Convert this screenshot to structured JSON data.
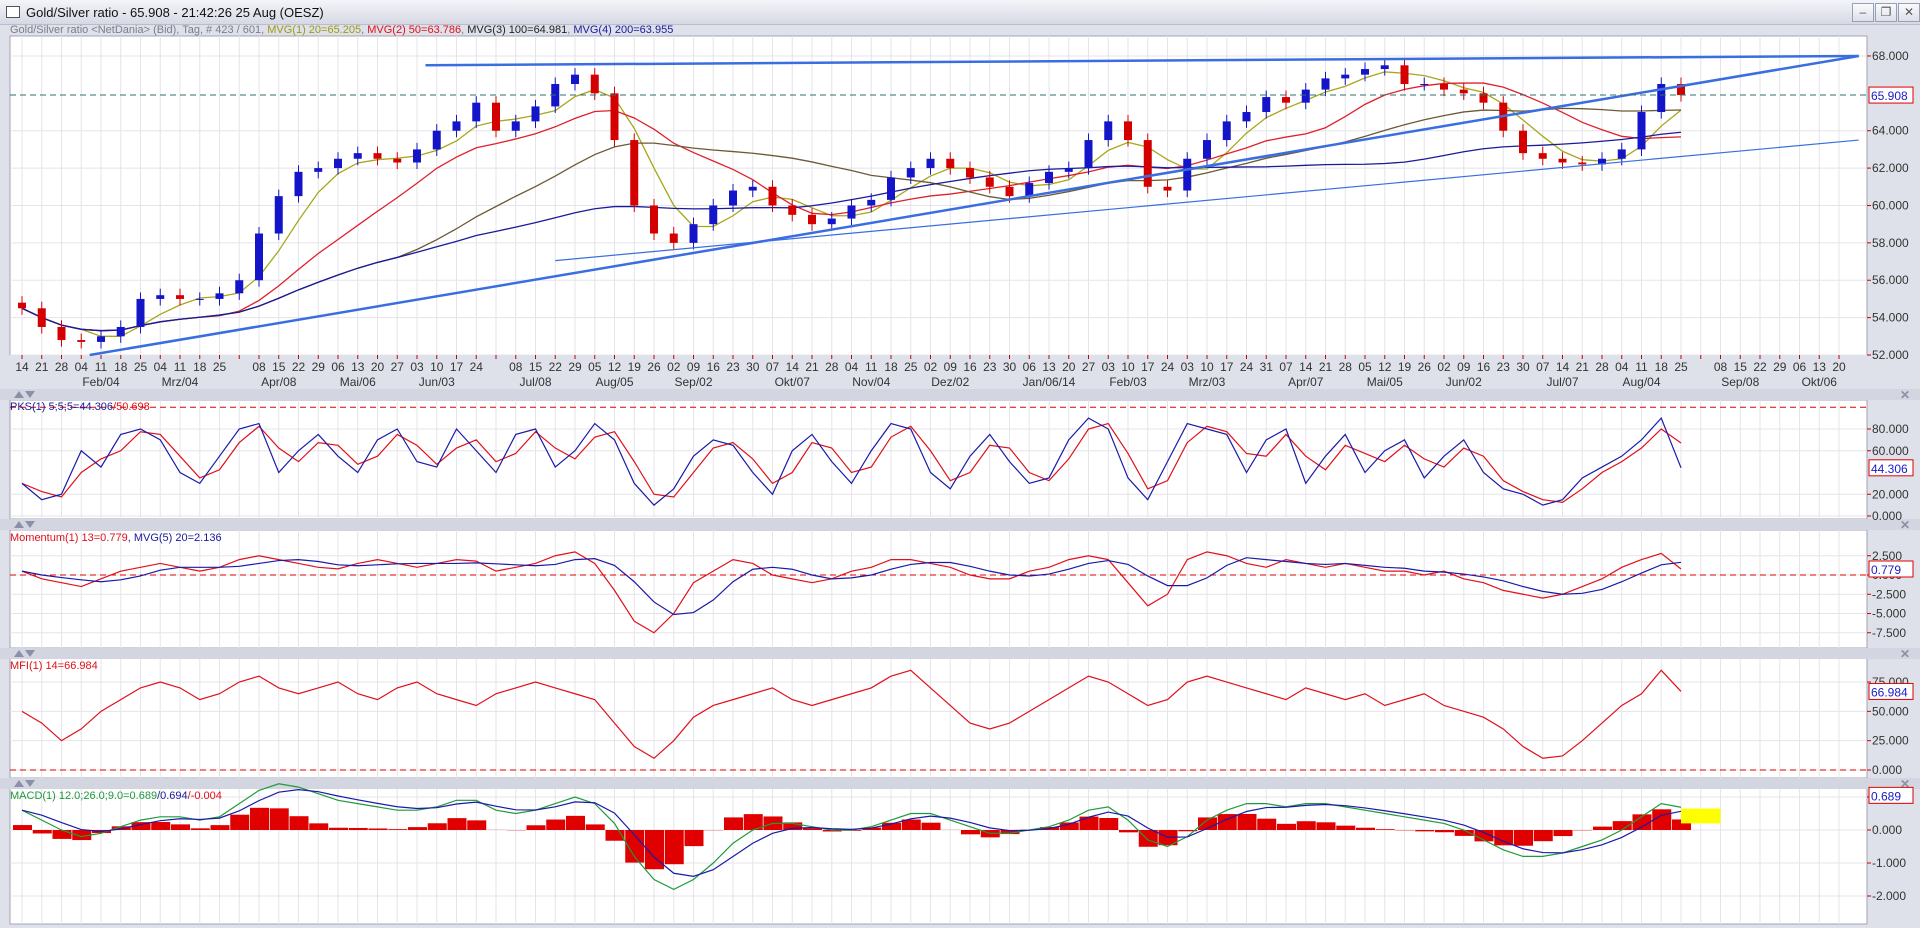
{
  "window": {
    "title": "Gold/Silver ratio - 65.908 - 21:42:26  25 Aug (OESZ)",
    "buttons": {
      "minimize": "–",
      "restore": "❐",
      "close": "✕"
    }
  },
  "legend": {
    "main_prefix": "Gold/Silver ratio <NetDania> (Bid), Tag, # 423 / 601",
    "mvg1": "MVG(1) 20=65.205",
    "mvg2": "MVG(2) 50=63.786",
    "mvg3": "MVG(3) 100=64.981",
    "mvg4": "MVG(4) 200=63.955",
    "sep": ", ",
    "pks_a": "PKS(1) 5;5;5=44.306",
    "pks_b": "/50.698",
    "mom_a": "Momentum(1) 13=0.779",
    "mom_b": "MVG(5) 20=2.136",
    "mfi": "MFI(1) 14=66.984",
    "macd_a": "MACD(1) 12.0;26.0;9.0=0.689",
    "macd_b": "/0.694",
    "macd_c": "/-0.004"
  },
  "colors": {
    "up_candle": "#1414c8",
    "down_candle": "#d40000",
    "mvg1": "#a8a61a",
    "mvg2": "#e0202a",
    "mvg3": "#6b5a34",
    "mvg4": "#1a1a9a",
    "trendline": "#3a6ee0",
    "price_line": "#2f6f6f",
    "pks_k": "#1a1aa8",
    "pks_d": "#e0101a",
    "momentum": "#e0101a",
    "momentum_ma": "#1a1aa8",
    "mfi": "#e0101a",
    "macd": "#1f9a3a",
    "macd_signal": "#1a1aa8",
    "macd_hist": "#e00000",
    "highlight": "#ffff00"
  },
  "chart_data": [
    {
      "type": "candlestick",
      "panel": "price",
      "x_ticks": [
        "14",
        "21",
        "28",
        "04",
        "11",
        "18",
        "25",
        "04",
        "11",
        "18",
        "25",
        "",
        "08",
        "15",
        "22",
        "29",
        "06",
        "13",
        "20",
        "27",
        "03",
        "10",
        "17",
        "24",
        "",
        "08",
        "15",
        "22",
        "29",
        "05",
        "12",
        "19",
        "26",
        "02",
        "09",
        "16",
        "23",
        "30",
        "07",
        "14",
        "21",
        "28",
        "04",
        "11",
        "18",
        "25",
        "02",
        "09",
        "16",
        "23",
        "30",
        "06",
        "13",
        "20",
        "27",
        "03",
        "10",
        "17",
        "24",
        "03",
        "10",
        "17",
        "24",
        "31",
        "07",
        "14",
        "21",
        "28",
        "05",
        "12",
        "19",
        "26",
        "02",
        "09",
        "16",
        "23",
        "30",
        "07",
        "14",
        "21",
        "28",
        "04",
        "11",
        "18",
        "25",
        "",
        "08",
        "15",
        "22",
        "29",
        "06",
        "13",
        "20"
      ],
      "months": [
        "Feb/04",
        "Mrz/04",
        "Apr/08",
        "Mai/06",
        "Jun/03",
        "Jul/08",
        "Aug/05",
        "Sep/02",
        "Okt/07",
        "Nov/04",
        "Dez/02",
        "Jan/06/14",
        "Feb/03",
        "Mrz/03",
        "Apr/07",
        "Mai/05",
        "Jun/02",
        "Jul/07",
        "Aug/04",
        "Sep/08",
        "Okt/06"
      ],
      "close": [
        54.5,
        53.5,
        52.8,
        52.7,
        53.0,
        53.5,
        55.0,
        55.2,
        55.0,
        55.0,
        55.3,
        56.0,
        58.5,
        60.5,
        61.8,
        62.0,
        62.5,
        62.8,
        62.5,
        62.3,
        63.0,
        64.0,
        64.5,
        65.5,
        64.0,
        64.5,
        65.3,
        66.5,
        67.0,
        66.0,
        63.5,
        60.0,
        58.5,
        58.0,
        59.0,
        60.0,
        60.8,
        61.0,
        60.0,
        59.5,
        59.0,
        59.3,
        60.0,
        60.3,
        61.5,
        62.0,
        62.5,
        62.0,
        61.5,
        61.0,
        60.5,
        61.2,
        61.8,
        62.0,
        63.5,
        64.5,
        63.5,
        61.0,
        60.8,
        62.5,
        63.5,
        64.5,
        65.0,
        65.8,
        65.5,
        66.2,
        66.8,
        67.0,
        67.3,
        67.5,
        66.5,
        66.5,
        66.2,
        66.0,
        65.5,
        64.0,
        62.8,
        62.5,
        62.3,
        62.2,
        62.5,
        63.0,
        65.0,
        66.5,
        65.908
      ],
      "moving_averages": [
        "MVG(1) 20",
        "MVG(2) 50",
        "MVG(3) 100",
        "MVG(4) 200"
      ],
      "current_value": "65.908",
      "y_ticks": [
        "52.000",
        "54.000",
        "56.000",
        "58.000",
        "60.000",
        "62.000",
        "64.000",
        "68.000"
      ],
      "ylim": [
        52,
        68
      ],
      "trendlines": [
        {
          "start": {
            "x": "2013-06-06",
            "y": 67.5
          },
          "end": {
            "x": "2014-10-27",
            "y": 68.0
          },
          "width": "thick"
        },
        {
          "start": {
            "x": "2013-02-07",
            "y": 52.0
          },
          "end": {
            "x": "2014-10-27",
            "y": 68.0
          },
          "width": "thick"
        },
        {
          "start": {
            "x": "2013-07-22",
            "y": 57.05
          },
          "end": {
            "x": "2014-10-27",
            "y": 63.5
          },
          "width": "thin"
        }
      ],
      "horizontal_line": 65.908,
      "grid": true
    },
    {
      "type": "line",
      "panel": "PKS",
      "k": [
        30,
        15,
        20,
        60,
        45,
        75,
        80,
        70,
        40,
        30,
        55,
        80,
        85,
        40,
        60,
        75,
        55,
        40,
        70,
        80,
        50,
        45,
        80,
        60,
        40,
        75,
        80,
        45,
        60,
        85,
        70,
        30,
        10,
        25,
        55,
        70,
        65,
        40,
        20,
        60,
        75,
        50,
        30,
        60,
        85,
        80,
        40,
        25,
        55,
        75,
        50,
        30,
        35,
        70,
        90,
        80,
        35,
        15,
        50,
        85,
        80,
        75,
        40,
        70,
        80,
        30,
        55,
        75,
        40,
        60,
        70,
        35,
        55,
        70,
        40,
        25,
        20,
        10,
        15,
        35,
        45,
        55,
        70,
        90,
        44.306
      ],
      "current_value": "44.306",
      "y_ticks": [
        "0.000",
        "20.000",
        "60.000",
        "80.000"
      ],
      "ylim": [
        0,
        100
      ],
      "reference_line": 100
    },
    {
      "type": "line",
      "panel": "Momentum",
      "values": [
        0.5,
        -0.5,
        -1,
        -1.5,
        -0.5,
        0.5,
        1,
        1.5,
        1,
        0.5,
        1,
        2,
        2.5,
        2,
        1.5,
        1,
        0.8,
        1.5,
        2,
        1.5,
        1,
        1.5,
        2,
        1.8,
        0.5,
        1,
        1.5,
        2.5,
        3,
        1.5,
        -2,
        -6,
        -7.5,
        -5,
        -1,
        0.5,
        2,
        1.5,
        0,
        -0.5,
        -1,
        -0.5,
        0.5,
        1,
        2,
        2,
        1.5,
        1,
        0,
        -0.5,
        -0.5,
        0.5,
        1,
        2,
        2.5,
        2,
        -1,
        -4,
        -2.5,
        2,
        3,
        2.5,
        1.5,
        1,
        2,
        1.5,
        1,
        1.5,
        1,
        0.5,
        0.5,
        0,
        0.5,
        -0.5,
        -1,
        -2,
        -2.5,
        -3,
        -2.5,
        -1.5,
        -0.5,
        1,
        2,
        2.8,
        0.779
      ],
      "current_value": "0.779",
      "y_ticks": [
        "2.500",
        "0.000",
        "-2.500",
        "-5.000",
        "-7.500"
      ],
      "ylim": [
        -8.5,
        5
      ],
      "reference_line": 0
    },
    {
      "type": "line",
      "panel": "MFI",
      "values": [
        50,
        40,
        25,
        35,
        50,
        60,
        70,
        75,
        70,
        60,
        65,
        75,
        80,
        70,
        65,
        70,
        75,
        65,
        60,
        70,
        75,
        65,
        60,
        55,
        65,
        70,
        75,
        70,
        65,
        60,
        40,
        20,
        10,
        25,
        45,
        55,
        60,
        65,
        70,
        60,
        55,
        60,
        65,
        70,
        80,
        85,
        70,
        55,
        40,
        35,
        40,
        50,
        60,
        70,
        80,
        75,
        65,
        55,
        60,
        75,
        80,
        75,
        70,
        65,
        60,
        70,
        65,
        60,
        65,
        55,
        60,
        65,
        55,
        50,
        45,
        35,
        20,
        10,
        12,
        25,
        40,
        55,
        65,
        85,
        66.984
      ],
      "current_value": "66.984",
      "y_ticks": [
        "0.000",
        "25.000",
        "50.000",
        "75.000"
      ],
      "ylim": [
        0,
        100
      ],
      "reference_line": 0
    },
    {
      "type": "line",
      "panel": "MACD",
      "macd": [
        0.6,
        0.3,
        0,
        -0.2,
        -0.1,
        0.1,
        0.3,
        0.4,
        0.4,
        0.3,
        0.4,
        0.8,
        1.2,
        1.4,
        1.3,
        1.1,
        0.9,
        0.8,
        0.7,
        0.6,
        0.6,
        0.7,
        0.9,
        0.9,
        0.6,
        0.5,
        0.6,
        0.8,
        1.0,
        0.8,
        0.2,
        -0.8,
        -1.5,
        -1.8,
        -1.5,
        -1.0,
        -0.4,
        0,
        0.2,
        0.2,
        0.1,
        0,
        0,
        0.1,
        0.3,
        0.5,
        0.5,
        0.3,
        0.1,
        -0.1,
        -0.1,
        0,
        0.1,
        0.3,
        0.6,
        0.7,
        0.3,
        -0.3,
        -0.5,
        -0.2,
        0.3,
        0.6,
        0.8,
        0.8,
        0.7,
        0.8,
        0.8,
        0.7,
        0.6,
        0.5,
        0.4,
        0.3,
        0.2,
        0,
        -0.3,
        -0.6,
        -0.8,
        -0.8,
        -0.7,
        -0.5,
        -0.3,
        0,
        0.4,
        0.8,
        0.689
      ],
      "current_value": "0.689",
      "y_ticks": [
        "1.000",
        "0.000",
        "-1.000",
        "-2.000"
      ],
      "ylim": [
        -2.2,
        1.8
      ],
      "highlight_box": {
        "x": [
          "2014-08-25",
          "2014-09-08"
        ],
        "y": [
          0.2,
          0.65
        ]
      }
    }
  ]
}
